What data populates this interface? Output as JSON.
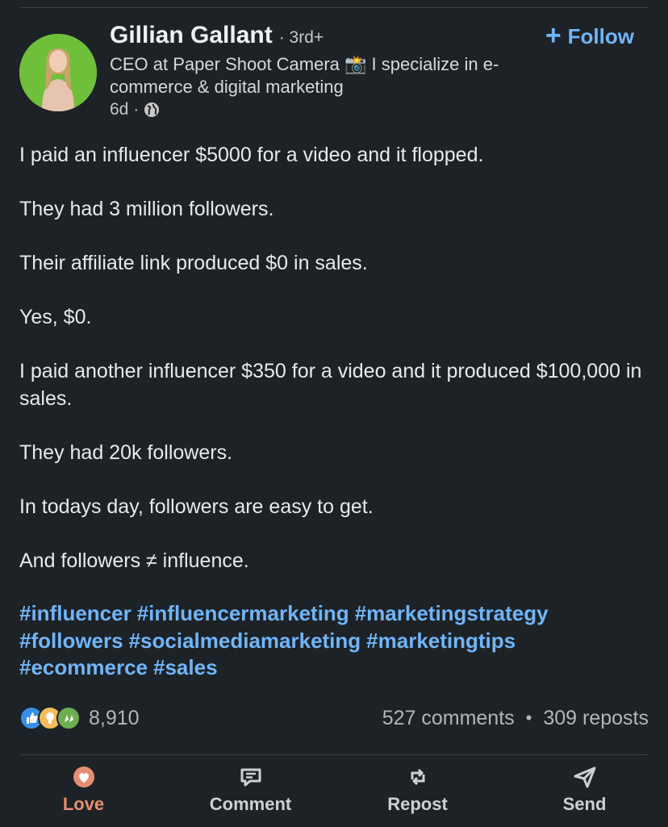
{
  "author": {
    "name": "Gillian Gallant",
    "degree": "· 3rd+",
    "headline": "CEO at Paper Shoot Camera 📸 I specialize in e-commerce & digital marketing",
    "time": "6d ·"
  },
  "follow_label": "Follow",
  "post": {
    "paragraphs": [
      "I paid an influencer $5000 for a video and it flopped.",
      "They had 3 million followers.",
      "Their affiliate link produced $0 in sales.",
      "Yes, $0.",
      "I paid another influencer $350 for a video and it produced $100,000 in sales.",
      "They had 20k followers.",
      "In todays day, followers are easy to get.",
      "And followers ≠ influence."
    ],
    "hashtags": [
      "#influencer",
      "#influencermarketing",
      "#marketingstrategy",
      "#followers",
      "#socialmediamarketing",
      "#marketingtips",
      "#ecommerce",
      "#sales"
    ]
  },
  "stats": {
    "reaction_count": "8,910",
    "comments": "527 comments",
    "separator": "•",
    "reposts": "309 reposts",
    "reaction_icons": [
      "like-icon",
      "insight-icon",
      "celebrate-icon"
    ]
  },
  "actions": {
    "love": "Love",
    "comment": "Comment",
    "repost": "Repost",
    "send": "Send"
  },
  "colors": {
    "background": "#1d2226",
    "link": "#70b5f9",
    "love": "#e58f72"
  }
}
